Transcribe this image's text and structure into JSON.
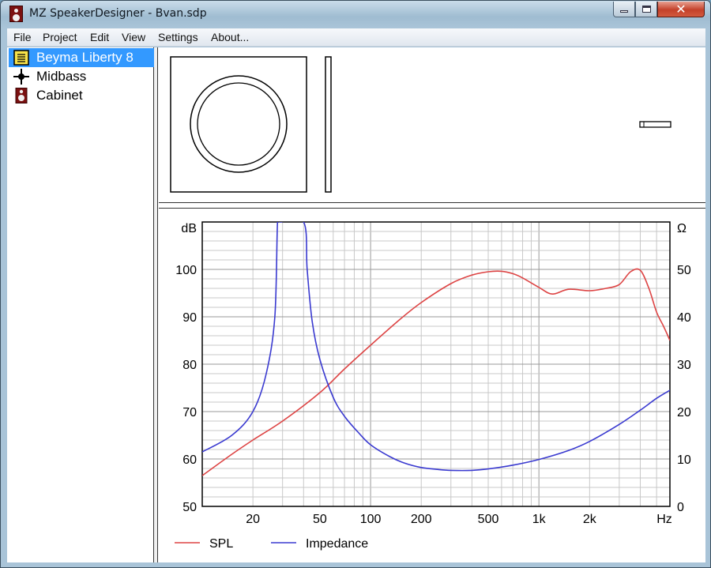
{
  "window": {
    "title": "MZ SpeakerDesigner - Bvan.sdp"
  },
  "menu": [
    "File",
    "Project",
    "Edit",
    "View",
    "Settings",
    "About..."
  ],
  "tree": [
    {
      "label": "Beyma Liberty 8",
      "icon": "driver-icon",
      "selected": true
    },
    {
      "label": "Midbass",
      "icon": "crossover-icon",
      "selected": false
    },
    {
      "label": "Cabinet",
      "icon": "cabinet-icon",
      "selected": false
    }
  ],
  "colors": {
    "spl": "#dd4444",
    "impedance": "#3a3ad0",
    "selection": "#3399ff",
    "grid": "#c8c8c8"
  },
  "chart_data": {
    "type": "line",
    "x_scale": "log",
    "xlim": [
      10,
      6000
    ],
    "x_ticks": [
      20,
      50,
      100,
      200,
      500,
      1000,
      2000
    ],
    "x_tick_labels": [
      "20",
      "50",
      "100",
      "200",
      "500",
      "1k",
      "2k"
    ],
    "x_unit": "Hz",
    "y_left": {
      "unit": "dB",
      "lim": [
        50,
        110
      ],
      "ticks": [
        50,
        60,
        70,
        80,
        90,
        100
      ]
    },
    "y_right": {
      "unit": "Ω",
      "lim": [
        0,
        60
      ],
      "ticks": [
        0,
        10,
        20,
        30,
        40,
        50
      ]
    },
    "grid": true,
    "legend": "bottom",
    "series": [
      {
        "name": "SPL",
        "axis": "left",
        "x": [
          10,
          15,
          20,
          30,
          50,
          70,
          100,
          150,
          200,
          300,
          400,
          500,
          600,
          700,
          800,
          1000,
          1200,
          1500,
          2000,
          2500,
          3000,
          3500,
          4000,
          4500,
          5000,
          5500,
          6000
        ],
        "y": [
          56.5,
          61,
          64,
          68,
          74,
          79,
          84,
          89.5,
          93,
          97,
          98.8,
          99.5,
          99.6,
          99.1,
          98.2,
          96.2,
          94.8,
          95.8,
          95.5,
          96,
          96.8,
          99.5,
          99.8,
          96,
          91,
          88,
          85
        ]
      },
      {
        "name": "Impedance",
        "axis": "right",
        "x": [
          10,
          15,
          20,
          24,
          27,
          28,
          29,
          40,
          42,
          45,
          50,
          60,
          70,
          85,
          100,
          130,
          160,
          200,
          250,
          300,
          400,
          500,
          700,
          1000,
          1500,
          2000,
          3000,
          4000,
          5000,
          6000
        ],
        "y": [
          11.5,
          15,
          20,
          28,
          40,
          60,
          60,
          60,
          50,
          39,
          31,
          23,
          19,
          15.5,
          13,
          10.5,
          9.1,
          8.2,
          7.8,
          7.6,
          7.6,
          7.9,
          8.7,
          9.9,
          11.8,
          13.7,
          17.3,
          20.3,
          22.8,
          24.5
        ]
      }
    ]
  }
}
